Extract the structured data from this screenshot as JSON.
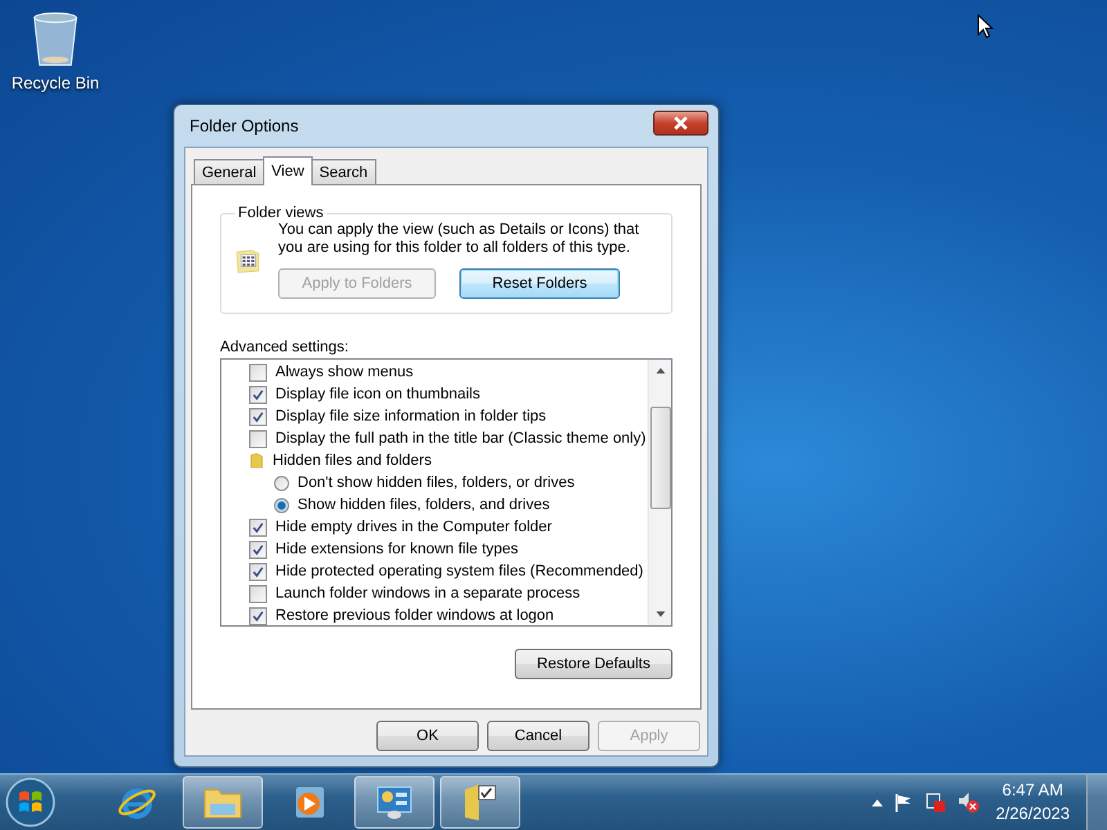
{
  "desktop_icons": [
    {
      "label": "Recycle Bin"
    }
  ],
  "window": {
    "title": "Folder Options",
    "tabs": [
      {
        "label": "General",
        "selected": false
      },
      {
        "label": "View",
        "selected": true
      },
      {
        "label": "Search",
        "selected": false
      }
    ],
    "folder_views": {
      "title": "Folder views",
      "description": "You can apply the view (such as Details or Icons) that you are using for this folder to all folders of this type.",
      "buttons": [
        {
          "label": "Apply to Folders",
          "disabled": true,
          "focused": false
        },
        {
          "label": "Reset Folders",
          "disabled": false,
          "focused": true
        }
      ]
    },
    "advanced_settings": {
      "label": "Advanced settings:",
      "items": [
        {
          "kind": "checkbox",
          "label": "Always show menus",
          "checked": false
        },
        {
          "kind": "checkbox",
          "label": "Display file icon on thumbnails",
          "checked": true
        },
        {
          "kind": "checkbox",
          "label": "Display file size information in folder tips",
          "checked": true
        },
        {
          "kind": "checkbox",
          "label": "Display the full path in the title bar (Classic theme only)",
          "checked": false
        },
        {
          "kind": "group",
          "label": "Hidden files and folders",
          "children": [
            {
              "kind": "radio",
              "label": "Don't show hidden files, folders, or drives",
              "selected": false
            },
            {
              "kind": "radio",
              "label": "Show hidden files, folders, and drives",
              "selected": true
            }
          ]
        },
        {
          "kind": "checkbox",
          "label": "Hide empty drives in the Computer folder",
          "checked": true
        },
        {
          "kind": "checkbox",
          "label": "Hide extensions for known file types",
          "checked": true
        },
        {
          "kind": "checkbox",
          "label": "Hide protected operating system files (Recommended)",
          "checked": true
        },
        {
          "kind": "checkbox",
          "label": "Launch folder windows in a separate process",
          "checked": false
        },
        {
          "kind": "checkbox",
          "label": "Restore previous folder windows at logon",
          "checked": true
        }
      ]
    },
    "restore_button": {
      "label": "Restore Defaults"
    },
    "buttons": [
      {
        "label": "OK",
        "disabled": false
      },
      {
        "label": "Cancel",
        "disabled": false
      },
      {
        "label": "Apply",
        "disabled": true
      }
    ]
  },
  "taskbar": {
    "apps": [
      {
        "kind": "browser",
        "running": false
      },
      {
        "kind": "explorer",
        "running": true
      },
      {
        "kind": "media",
        "running": false
      },
      {
        "kind": "control_panel",
        "running": true
      },
      {
        "kind": "folder_options",
        "running": true
      }
    ],
    "clock": {
      "time": "6:47 AM",
      "date": "2/26/2023"
    }
  }
}
